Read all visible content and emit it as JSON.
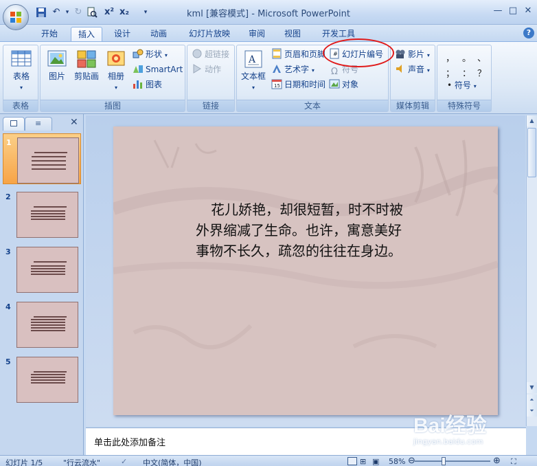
{
  "window": {
    "title": "kml [兼容模式] - Microsoft PowerPoint",
    "minimize": "—",
    "maximize": "□",
    "close": "✕"
  },
  "quick_access": {
    "icons": [
      "save-icon",
      "undo-icon",
      "redo-icon",
      "print-preview-icon",
      "superscript-icon",
      "subscript-icon",
      "customize-dropdown-icon"
    ],
    "superscript_label": "x²",
    "subscript_label": "x₂"
  },
  "tabs": [
    {
      "label": "开始",
      "active": false
    },
    {
      "label": "插入",
      "active": true
    },
    {
      "label": "设计",
      "active": false
    },
    {
      "label": "动画",
      "active": false
    },
    {
      "label": "幻灯片放映",
      "active": false
    },
    {
      "label": "审阅",
      "active": false
    },
    {
      "label": "视图",
      "active": false
    },
    {
      "label": "开发工具",
      "active": false
    }
  ],
  "ribbon": {
    "groups": {
      "table": {
        "label": "表格",
        "table_button": "表格"
      },
      "illustrations": {
        "label": "插图",
        "picture": "图片",
        "clipart": "剪贴画",
        "album": "相册",
        "shapes": "形状",
        "smartart": "SmartArt",
        "chart": "图表"
      },
      "links": {
        "label": "链接",
        "hyperlink": "超链接",
        "action": "动作"
      },
      "text": {
        "label": "文本",
        "textbox": "文本框",
        "header_footer": "页眉和页脚",
        "wordart": "艺术字",
        "datetime": "日期和时间",
        "slide_number": "幻灯片编号",
        "symbol": "符号",
        "object": "对象"
      },
      "media": {
        "label": "媒体剪辑",
        "movie": "影片",
        "sound": "声音"
      },
      "special_symbols": {
        "label": "特殊符号",
        "row1": [
          "，",
          "。",
          "、"
        ],
        "row2": [
          "；",
          "：",
          "？"
        ],
        "symbol_button": "符号"
      }
    }
  },
  "colors": {
    "accent_highlight_circle": "#e01a1a",
    "selected_thumbnail": "#f7a447",
    "slide_background": "#d7c3c1"
  },
  "slides_pane": {
    "tabs": [
      "slides-tab-icon",
      "outline-tab-icon"
    ],
    "close": "✕",
    "thumbnails": [
      {
        "number": "1",
        "selected": true
      },
      {
        "number": "2",
        "selected": false
      },
      {
        "number": "3",
        "selected": false
      },
      {
        "number": "4",
        "selected": false
      },
      {
        "number": "5",
        "selected": false
      }
    ]
  },
  "slide": {
    "text": "花儿娇艳，却很短暂，时不时被外界缩减了生命。也许，寓意美好事物不长久，疏忽的往往在身边。"
  },
  "notes": {
    "placeholder": "单击此处添加备注"
  },
  "status_bar": {
    "slide_position": "幻灯片 1/5",
    "theme": "\"行云流水\"",
    "language": "中文(简体，中国)",
    "zoom": "58%",
    "zoom_level_percent": 58
  },
  "watermark": {
    "brand": "Bai经验",
    "url": "jingyan.baidu.com"
  }
}
